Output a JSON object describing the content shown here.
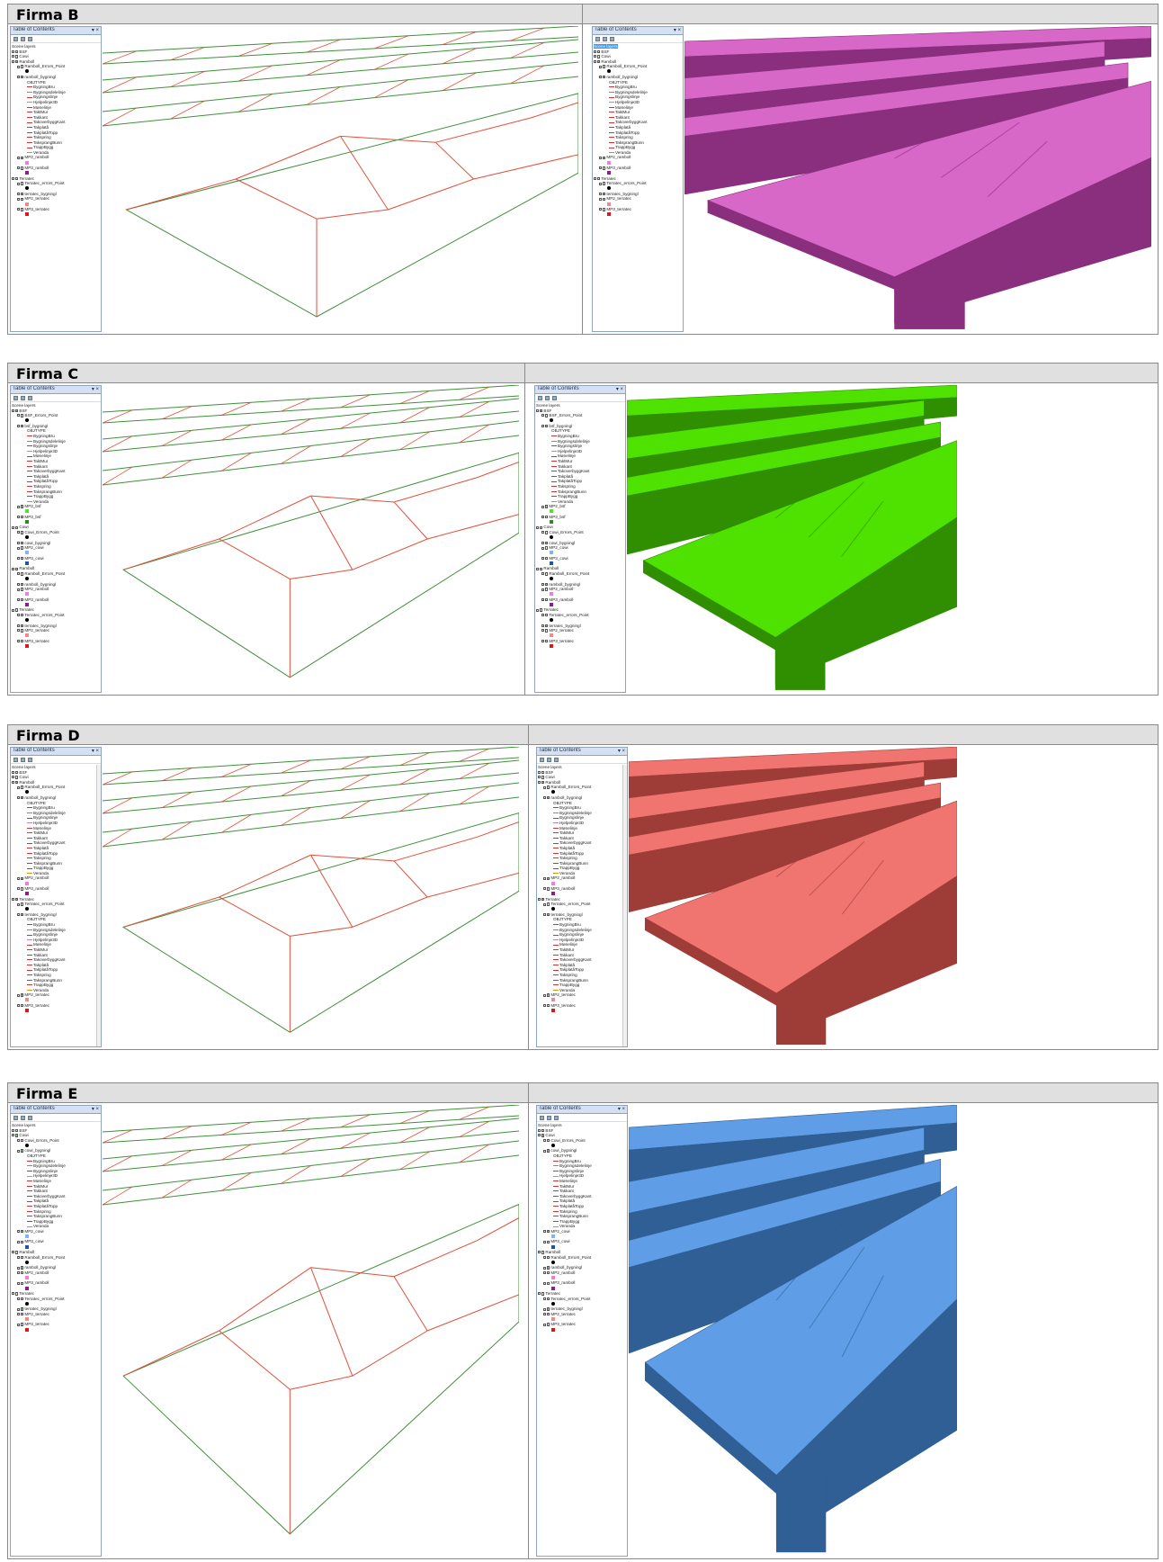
{
  "sections": [
    {
      "id": "b",
      "title": "Firma B",
      "color": "#d868c8",
      "dark": "#8a2f7e"
    },
    {
      "id": "c",
      "title": "Firma C",
      "color": "#4fe200",
      "dark": "#2f8f00"
    },
    {
      "id": "d",
      "title": "Firma D",
      "color": "#f07570",
      "dark": "#9e3c38"
    },
    {
      "id": "e",
      "title": "Firma E",
      "color": "#5f9de6",
      "dark": "#2f5f95"
    }
  ],
  "toc": {
    "title": "Table of Contents",
    "close": "▾ ×",
    "scene_layers": "Scene layers"
  },
  "toc_items": {
    "bsf": "BSF",
    "cowi": "Cowi",
    "ramboll": "Ramboll",
    "terratec": "Terratec",
    "bsf_errors": "BSF_Errors_Point",
    "cowi_errors": "Cowi_Errors_Point",
    "ramboll_errors": "Ramboll_Errors_Point",
    "terratec_errors": "Terratec_errors_Point",
    "bsf_bygning": "bsf_bygningl",
    "cowi_bygning": "cowi_bygningl",
    "ramboll_bygning": "ramboll_bygningl",
    "terratec_bygning": "terratec_bygningl",
    "objtype": "OBJTYPE",
    "mp2_bsf": "MP2_bsf",
    "mp3_bsf": "MP3_bsf",
    "mp2_cowi": "MP2_cowi",
    "mp3_cowi": "MP3_cowi",
    "mp2_ramboll": "MP2_ramboll",
    "mp3_ramboll": "MP3_ramboll",
    "mp2_terratec": "MP2_terratec",
    "mp3_terratec": "MP3_terratec"
  },
  "objtypes": [
    "BygningBru",
    "Bygningsdelelinje",
    "Bygningslinje",
    "Hjelpelinje3D",
    "Mønelinje",
    "TaktMur",
    "Takkant",
    "TakoverbyggKant",
    "Takplatå",
    "TakplatåTopp",
    "Takspring",
    "TaksprangBunn",
    "TrappBygg",
    "Veranda"
  ],
  "swatch_colors": {
    "bsf_mp2": "#59e02a",
    "bsf_mp3": "#2c8b1a",
    "cowi_mp2": "#7fb5f0",
    "cowi_mp3": "#1f53a8",
    "ramboll_mp2": "#f07ddd",
    "ramboll_mp3": "#8f1d86",
    "terratec_mp2": "#f08a8a",
    "terratec_mp3": "#e01515"
  },
  "icons": {
    "close": "close-icon",
    "expand": "expand-icon"
  }
}
